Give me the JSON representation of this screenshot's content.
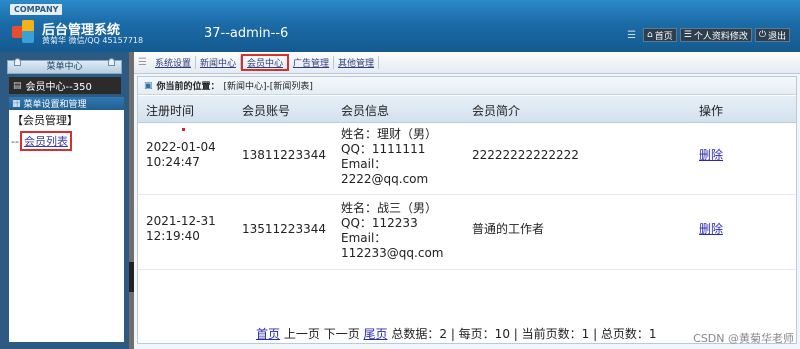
{
  "header": {
    "company": "COMPANY",
    "system_title": "后台管理系统",
    "system_subtitle": "黄菊华 微信/QQ 45157718",
    "user_info": "37--admin--6",
    "buttons": [
      {
        "icon": "home-icon",
        "glyph": "⌂",
        "label": "首页"
      },
      {
        "icon": "list-icon",
        "glyph": "☰",
        "label": "个人资料修改"
      },
      {
        "icon": "power-icon",
        "glyph": "⏻",
        "label": "退出"
      }
    ]
  },
  "sidebar": {
    "heading": "菜单中心",
    "member_center": "会员中心--350",
    "menu_title": "菜单设置和管理",
    "group": "【会员管理】",
    "item_prefix": "--",
    "item": "会员列表"
  },
  "nav": {
    "items": [
      "系统设置",
      "新闻中心",
      "会员中心",
      "广告管理",
      "其他管理"
    ],
    "active_index": 2
  },
  "breadcrumb": {
    "label": "你当前的位置：",
    "path": "[新闻中心]-[新闻列表]"
  },
  "table": {
    "headers": [
      "注册时间",
      "会员账号",
      "会员信息",
      "会员简介",
      "操作"
    ],
    "rows": [
      {
        "time_date": "2022-01-04",
        "time_clock": "10:24:47",
        "account": "13811223344",
        "info": [
          "姓名：理财（男）",
          "QQ：1111111",
          "Email：",
          "2222@qq.com"
        ],
        "intro": "22222222222222",
        "action": "删除"
      },
      {
        "time_date": "2021-12-31",
        "time_clock": "12:19:40",
        "account": "13511223344",
        "info": [
          "姓名：战三（男）",
          "QQ：112233",
          "Email：",
          "112233@qq.com"
        ],
        "intro": "普通的工作者",
        "action": "删除"
      }
    ]
  },
  "pager": {
    "first": "首页",
    "prev": "上一页",
    "next": "下一页",
    "last": "尾页",
    "stats": "总数据：2 | 每页：10 | 当前页数：1 | 总页数：1"
  },
  "watermark": "CSDN @黄菊华老师"
}
